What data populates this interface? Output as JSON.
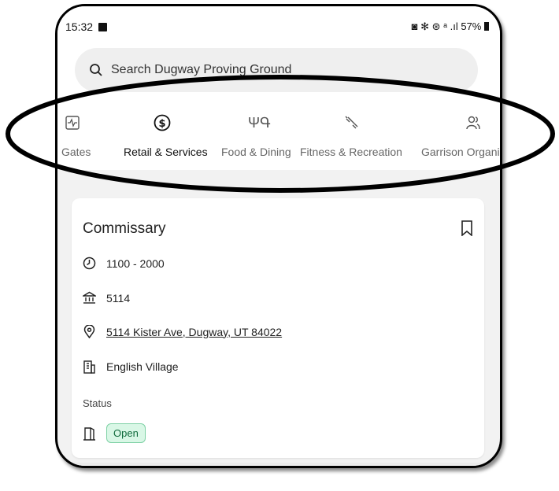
{
  "status_bar": {
    "time": "15:32",
    "battery": "57%",
    "indicators": "◙ ✻ ⊛ ᵃ .ıl"
  },
  "search": {
    "placeholder": "Search Dugway Proving Ground"
  },
  "tabs": [
    {
      "label": "Gates",
      "icon": "pulse-icon"
    },
    {
      "label": "Retail & Services",
      "icon": "dollar-icon",
      "active": true
    },
    {
      "label": "Food & Dining",
      "icon": "fork-knife-icon"
    },
    {
      "label": "Fitness & Recreation",
      "icon": "dumbbell-icon"
    },
    {
      "label": "Garrison Organiza",
      "icon": "people-icon"
    }
  ],
  "card": {
    "title": "Commissary",
    "hours": "1100 - 2000",
    "building": "5114",
    "address": "5114 Kister Ave, Dugway, UT 84022",
    "area": "English Village",
    "status_label": "Status",
    "status_value": "Open"
  },
  "colors": {
    "accent": "#222222",
    "open_badge_bg": "#d9f7e6",
    "open_badge_border": "#7ed1a5"
  }
}
